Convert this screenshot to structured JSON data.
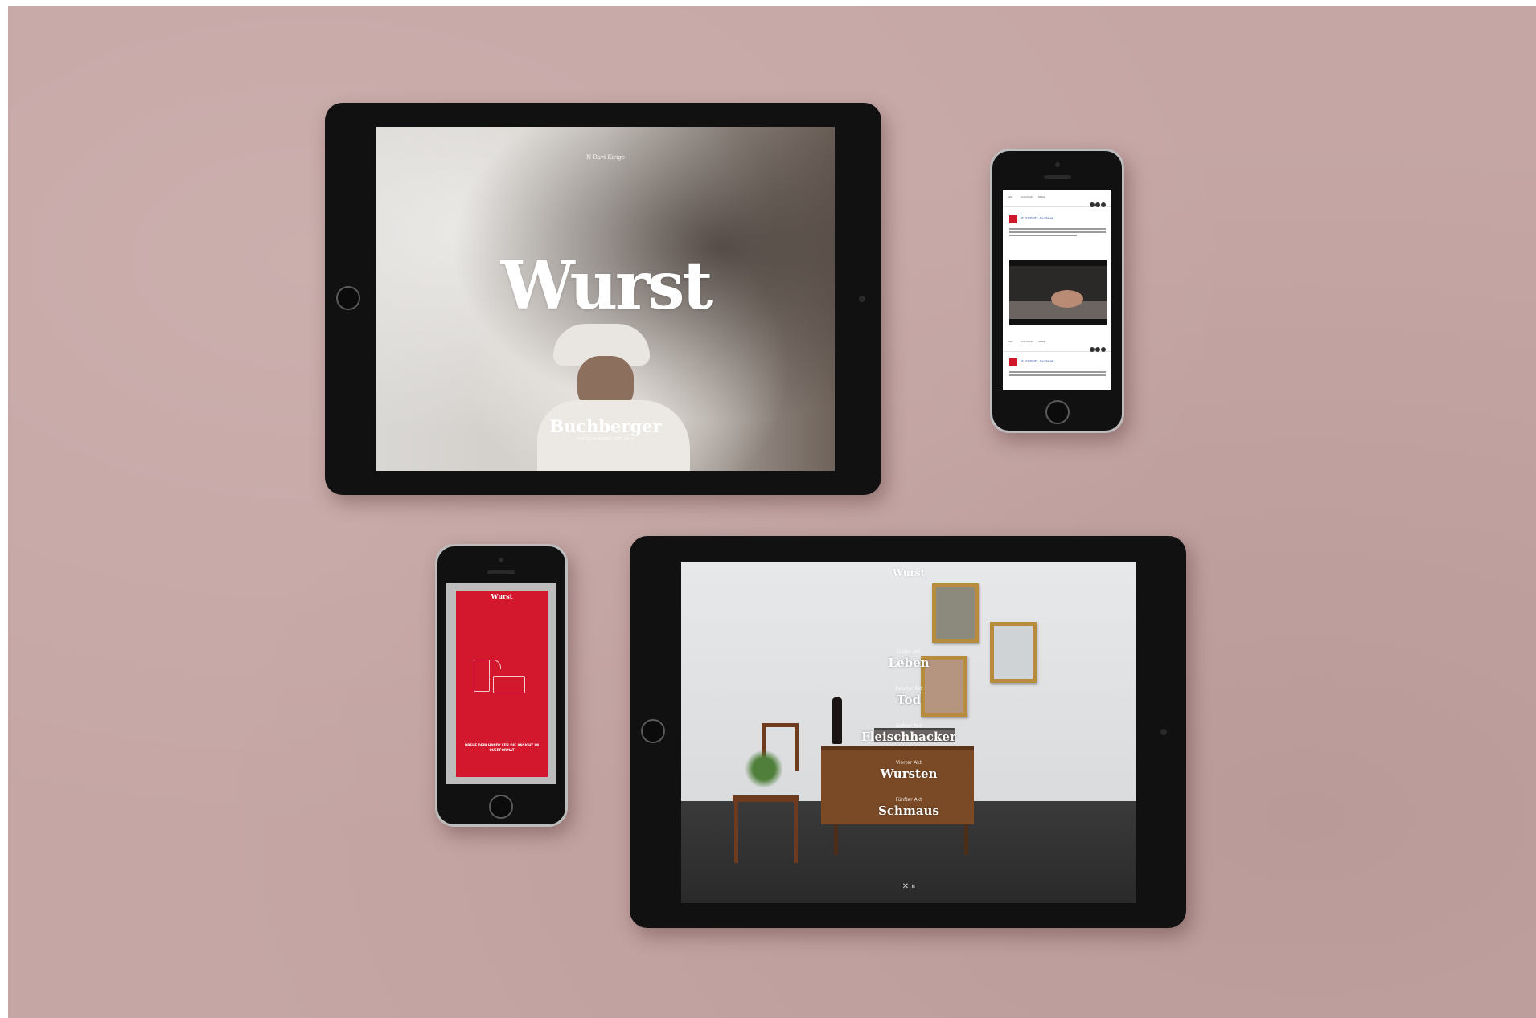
{
  "tablet_hero": {
    "brand_mark": "N Ravi Kirige",
    "title": "Wurst",
    "subtitle": "Buchberger",
    "subtitle_small": "FLEISCHHAUEREI SEIT 1883"
  },
  "phone_feed": {
    "tabs": [
      "Like",
      "Comment",
      "Share"
    ],
    "post_name": "ST. CHATOUFF - Buchberger"
  },
  "phone_rotate": {
    "title": "Wurst",
    "message": "DREHE DEIN HANDY FÜR DIE ANSICHT IM QUERFORMAT"
  },
  "tablet_menu": {
    "title": "Wurst",
    "acts": [
      {
        "small": "Erster Akt",
        "big": "Leben"
      },
      {
        "small": "Zweiter Akt",
        "big": "Tod"
      },
      {
        "small": "Dritter Akt",
        "big": "Fleischhacker"
      },
      {
        "small": "Vierter Akt",
        "big": "Wursten"
      },
      {
        "small": "Fünfter Akt",
        "big": "Schmaus"
      }
    ],
    "controls": "✕   ⏸"
  },
  "colors": {
    "backdrop": "#c5a6a4",
    "device": "#111111",
    "brand_red": "#d3172c"
  }
}
